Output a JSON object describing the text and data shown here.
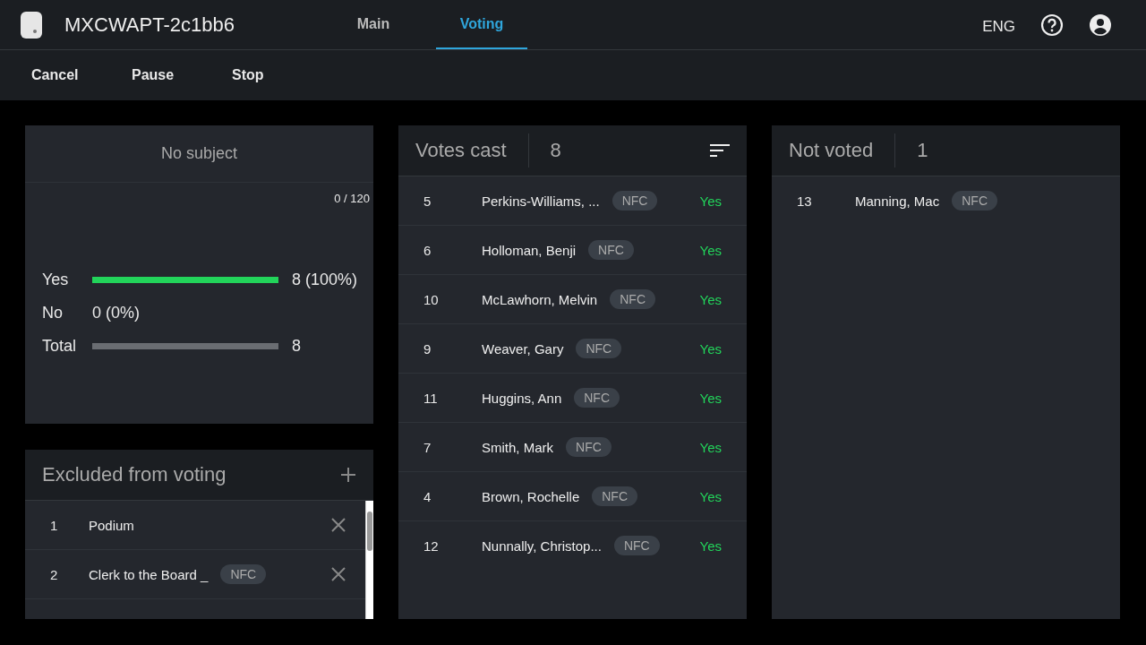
{
  "app": {
    "title": "MXCWAPT-2c1bb6",
    "tabs": [
      {
        "label": "Main",
        "selected": false
      },
      {
        "label": "Voting",
        "selected": true
      }
    ],
    "language": "ENG"
  },
  "toolbar": {
    "buttons": [
      "Cancel",
      "Pause",
      "Stop"
    ]
  },
  "summary": {
    "subject": "No subject",
    "counter": "0 / 120",
    "results": [
      {
        "label": "Yes",
        "level": 1,
        "reading": "8 (100%)",
        "kind": "bar"
      },
      {
        "label": "No",
        "reading": "0 (0%)",
        "kind": "plain"
      },
      {
        "label": "Total",
        "level": 1,
        "reading": "8",
        "kind": "total"
      }
    ]
  },
  "excluded": {
    "title": "Excluded from voting",
    "rows": [
      {
        "number": "1",
        "name": "Podium"
      },
      {
        "number": "2",
        "name": "Clerk to the Board _",
        "tag": "NFC"
      }
    ]
  },
  "votes_cast": {
    "title": "Votes cast",
    "count": "8",
    "rows": [
      {
        "number": "5",
        "name": "Perkins-Williams, ...",
        "tag": "NFC",
        "vote": "Yes"
      },
      {
        "number": "6",
        "name": "Holloman, Benji",
        "tag": "NFC",
        "vote": "Yes"
      },
      {
        "number": "10",
        "name": "McLawhorn, Melvin",
        "tag": "NFC",
        "vote": "Yes"
      },
      {
        "number": "9",
        "name": "Weaver, Gary",
        "tag": "NFC",
        "vote": "Yes"
      },
      {
        "number": "11",
        "name": "Huggins, Ann",
        "tag": "NFC",
        "vote": "Yes"
      },
      {
        "number": "7",
        "name": "Smith, Mark",
        "tag": "NFC",
        "vote": "Yes"
      },
      {
        "number": "4",
        "name": "Brown, Rochelle",
        "tag": "NFC",
        "vote": "Yes"
      },
      {
        "number": "12",
        "name": "Nunnally, Christop...",
        "tag": "NFC",
        "vote": "Yes"
      }
    ]
  },
  "not_voted": {
    "title": "Not voted",
    "count": "1",
    "rows": [
      {
        "number": "13",
        "name": "Manning, Mac",
        "tag": "NFC"
      }
    ]
  }
}
